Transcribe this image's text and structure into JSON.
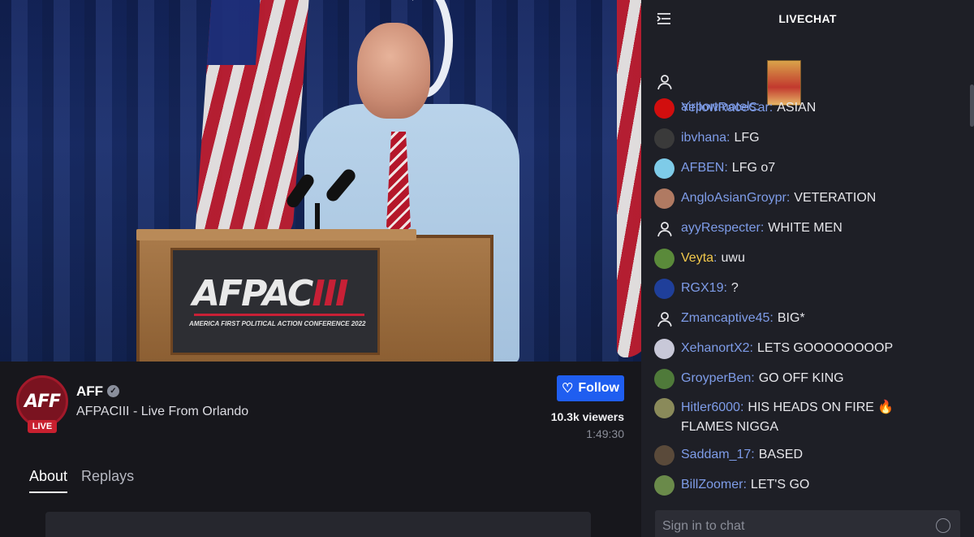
{
  "video": {
    "sign_logo": "AFPAC",
    "sign_logo_roman": "III",
    "sign_tagline": "AMERICA FIRST POLITICAL ACTION CONFERENCE 2022"
  },
  "channel": {
    "avatar_text": "AFF",
    "live_badge": "LIVE",
    "name": "AFF",
    "stream_title": "AFPACIII - Live From Orlando",
    "follow_label": "Follow",
    "viewers": "10.3k viewers",
    "uptime": "1:49:30",
    "tabs": [
      {
        "label": "About",
        "active": true
      },
      {
        "label": "Replays",
        "active": false
      }
    ]
  },
  "chat": {
    "title": "LIVECHAT",
    "input_placeholder": "Sign in to chat",
    "messages": [
      {
        "user": "airportmotels",
        "text": "",
        "avatar": "user-icon",
        "sticker": true
      },
      {
        "user": "YellowRaceCar",
        "text": "ASIAN",
        "avatar": "#d10e0e"
      },
      {
        "user": "ibvhana",
        "text": "LFG",
        "avatar": "#3a3a3a"
      },
      {
        "user": "AFBEN",
        "text": "LFG o7",
        "avatar": "#7ecbe8"
      },
      {
        "user": "AngloAsianGroypr",
        "text": "VETERATION",
        "avatar": "#b07a62"
      },
      {
        "user": "ayyRespecter",
        "text": "WHITE MEN",
        "avatar": "user-icon"
      },
      {
        "user": "Veyta",
        "text": "uwu",
        "avatar": "#5a8a3a",
        "gold": true
      },
      {
        "user": "RGX19",
        "text": "?",
        "avatar": "#1f3f9a"
      },
      {
        "user": "Zmancaptive45",
        "text": "BIG*",
        "avatar": "user-icon"
      },
      {
        "user": "XehanortX2",
        "text": "LETS GOOOOOOOOP",
        "avatar": "#c8c8d8"
      },
      {
        "user": "GroyperBen",
        "text": "GO OFF KING",
        "avatar": "#4f7a3a"
      },
      {
        "user": "Hitler6000",
        "text": "HIS HEADS ON FIRE 🔥 FLAMES NIGGA",
        "avatar": "#8a8a5a"
      },
      {
        "user": "Saddam_17",
        "text": "BASED",
        "avatar": "#5a4a3a"
      },
      {
        "user": "BillZoomer",
        "text": "LET'S GO",
        "avatar": "#6a8a4a"
      }
    ]
  }
}
